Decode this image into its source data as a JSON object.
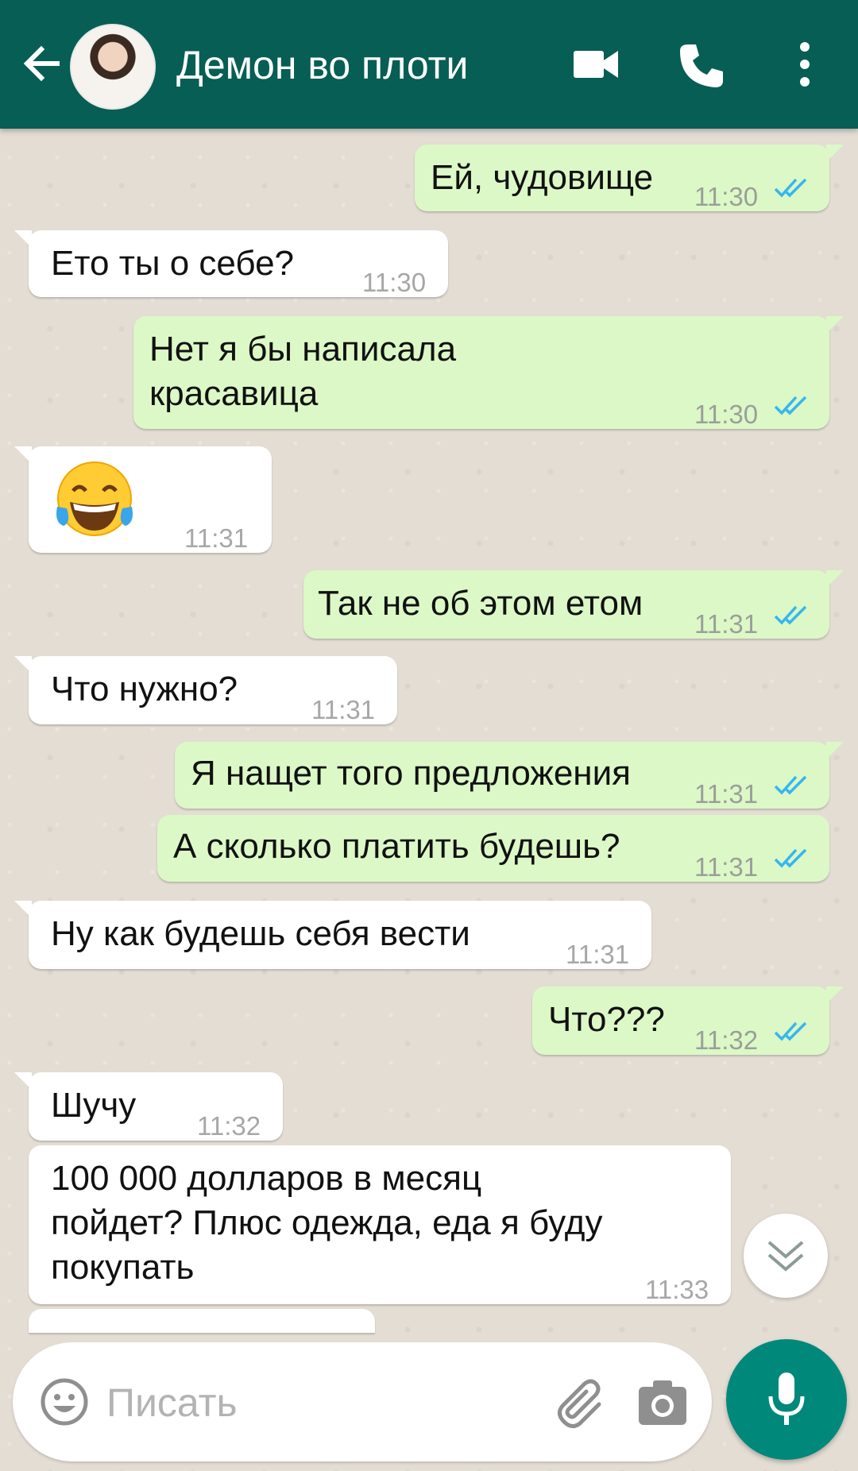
{
  "header": {
    "contact_name": "Демон во плоти",
    "icons": [
      "back-arrow-icon",
      "avatar",
      "video-call-icon",
      "phone-call-icon",
      "more-vert-icon"
    ]
  },
  "colors": {
    "header": "#075e54",
    "outgoing_bubble": "#dcf8c6",
    "incoming_bubble": "#ffffff",
    "read_ticks": "#34b7f1",
    "mic_button": "#00897b"
  },
  "messages": [
    {
      "dir": "out",
      "text": "Ей, чудовище",
      "time": "11:30",
      "status": "read"
    },
    {
      "dir": "in",
      "text": "Ето ты о себе?",
      "time": "11:30"
    },
    {
      "dir": "out",
      "line1": "Нет я бы написала",
      "line2": "красавица",
      "time": "11:30",
      "status": "read"
    },
    {
      "dir": "in",
      "emoji": "😂",
      "time": "11:31"
    },
    {
      "dir": "out",
      "text": "Так не об этом етом",
      "time": "11:31",
      "status": "read"
    },
    {
      "dir": "in",
      "text": "Что нужно?",
      "time": "11:31"
    },
    {
      "dir": "out",
      "text": "Я нащет того предложения",
      "time": "11:31",
      "status": "read"
    },
    {
      "dir": "out",
      "text": "А сколько платить будешь?",
      "time": "11:31",
      "status": "read"
    },
    {
      "dir": "in",
      "text": "Ну как будешь себя вести",
      "time": "11:31"
    },
    {
      "dir": "out",
      "text": "Что???",
      "time": "11:32",
      "status": "read"
    },
    {
      "dir": "in",
      "text": "Шучу",
      "time": "11:32"
    },
    {
      "dir": "in",
      "line1": "100 000  долларов в месяц",
      "line2": "пойдет?  Плюс одежда, еда я буду",
      "line3": "покупать",
      "time": "11:33"
    }
  ],
  "input": {
    "placeholder": "Писать",
    "value": ""
  }
}
